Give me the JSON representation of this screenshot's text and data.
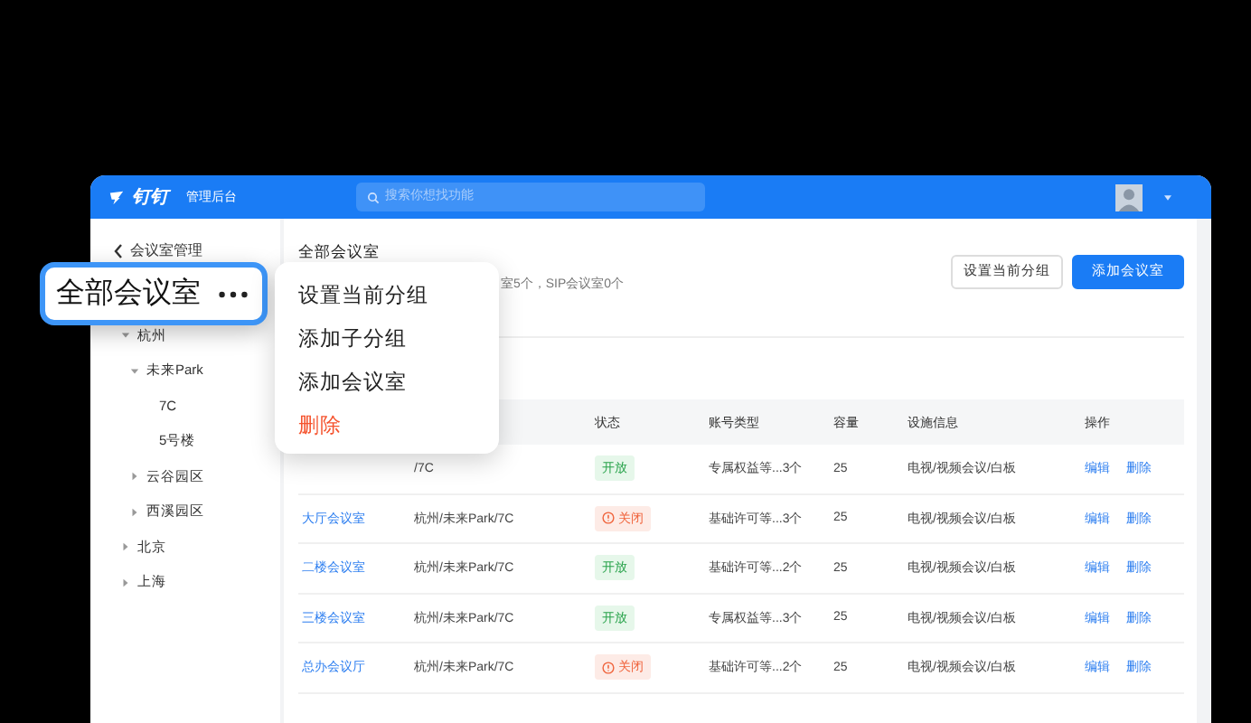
{
  "header": {
    "logo": "钉钉",
    "title": "管理后台",
    "search": {
      "placeholder": "搜索你想找功能"
    }
  },
  "sidebar": {
    "back": "会议室管理",
    "tree": [
      {
        "label": "杭州",
        "expanded": true,
        "children": [
          {
            "label": "未来Park",
            "expanded": true,
            "children": [
              {
                "label": "7C"
              },
              {
                "label": "5号楼"
              }
            ]
          },
          {
            "label": "云谷园区",
            "expanded": false
          },
          {
            "label": "西溪园区",
            "expanded": false
          }
        ]
      },
      {
        "label": "北京",
        "expanded": false
      },
      {
        "label": "上海",
        "expanded": false
      }
    ]
  },
  "callout": {
    "label": "全部会议室"
  },
  "menu": {
    "items": [
      {
        "label": "设置当前分组",
        "kind": "normal"
      },
      {
        "label": "添加子分组",
        "kind": "normal"
      },
      {
        "label": "添加会议室",
        "kind": "normal"
      },
      {
        "label": "删除",
        "kind": "danger"
      }
    ]
  },
  "content": {
    "title": "全部会议室",
    "subtitle": "室5个，SIP会议室0个",
    "buttons": [
      {
        "label": "设置当前分组",
        "kind": "default"
      },
      {
        "label": "添加会议室",
        "kind": "primary"
      }
    ]
  },
  "table": {
    "columns": [
      "状态",
      "账号类型",
      "容量",
      "设施信息",
      "操作"
    ],
    "rows": [
      {
        "location": "/7C",
        "status": {
          "kind": "open",
          "label": "开放"
        },
        "account": "专属权益等...3个",
        "capacity": "25",
        "facility": "电视/视频会议/白板",
        "actions": [
          "编辑",
          "删除"
        ]
      },
      {
        "name": "大厅会议室",
        "location": "杭州/未来Park/7C",
        "status": {
          "kind": "closed",
          "label": "关闭"
        },
        "account": "基础许可等...3个",
        "capacity": "25",
        "facility": "电视/视频会议/白板",
        "actions": [
          "编辑",
          "删除"
        ]
      },
      {
        "name": "二楼会议室",
        "location": "杭州/未来Park/7C",
        "status": {
          "kind": "open",
          "label": "开放"
        },
        "account": "基础许可等...2个",
        "capacity": "25",
        "facility": "电视/视频会议/白板",
        "actions": [
          "编辑",
          "删除"
        ]
      },
      {
        "name": "三楼会议室",
        "location": "杭州/未来Park/7C",
        "status": {
          "kind": "open",
          "label": "开放"
        },
        "account": "专属权益等...3个",
        "capacity": "25",
        "facility": "电视/视频会议/白板",
        "actions": [
          "编辑",
          "删除"
        ]
      },
      {
        "name": "总办会议厅",
        "location": "杭州/未来Park/7C",
        "status": {
          "kind": "closed",
          "label": "关闭"
        },
        "account": "基础许可等...2个",
        "capacity": "25",
        "facility": "电视/视频会议/白板",
        "actions": [
          "编辑",
          "删除"
        ]
      }
    ]
  }
}
